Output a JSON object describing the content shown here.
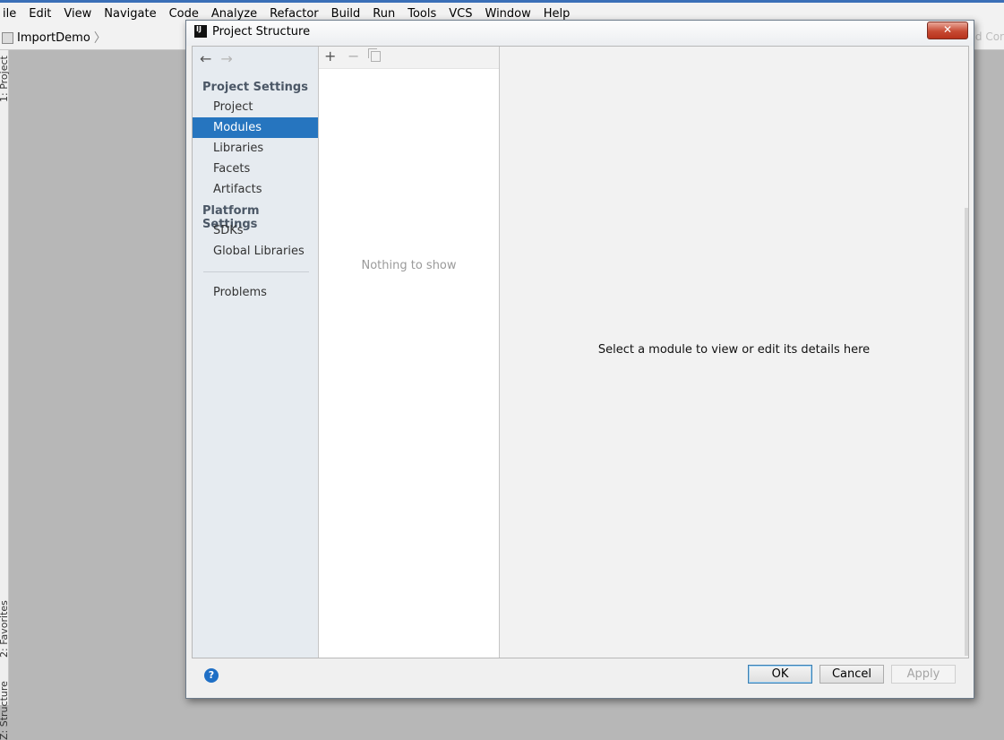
{
  "ide": {
    "menu": [
      "ile",
      "Edit",
      "View",
      "Navigate",
      "Code",
      "Analyze",
      "Refactor",
      "Build",
      "Run",
      "Tools",
      "VCS",
      "Window",
      "Help"
    ],
    "breadcrumb": "ImportDemo",
    "breadcrumb_sep": "〉",
    "navbar_right_text": "d Cor",
    "stripe_labels": [
      "1: Project",
      "2: Favorites",
      "Z: Structure"
    ]
  },
  "dialog": {
    "title": "Project Structure",
    "logo_text": "IJ",
    "close_glyph": "✕",
    "nav": {
      "back": "←",
      "forward": "→"
    },
    "sidebar": {
      "project_settings_title": "Project Settings",
      "project_settings_items": [
        "Project",
        "Modules",
        "Libraries",
        "Facets",
        "Artifacts"
      ],
      "selected_item": "Modules",
      "platform_settings_title": "Platform Settings",
      "platform_settings_items": [
        "SDKs",
        "Global Libraries"
      ],
      "problems": "Problems"
    },
    "list": {
      "toolbar": {
        "add": "+",
        "remove": "−"
      },
      "empty_text": "Nothing to show"
    },
    "details": {
      "placeholder": "Select a module to view or edit its details here"
    },
    "footer": {
      "help": "?",
      "ok": "OK",
      "cancel": "Cancel",
      "apply": "Apply"
    }
  },
  "colors": {
    "selection": "#2675bf",
    "sidebar_bg": "#e6ebf0",
    "dialog_bg": "#f2f2f2",
    "close_button": "#c74a33"
  }
}
